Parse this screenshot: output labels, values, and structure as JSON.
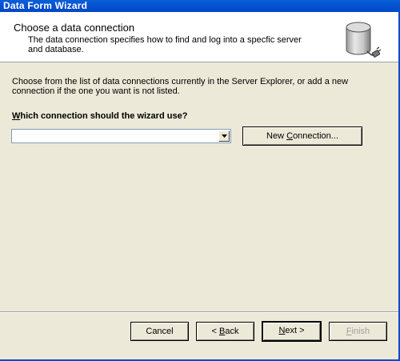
{
  "window": {
    "title": "Data Form Wizard"
  },
  "header": {
    "title": "Choose a data connection",
    "description": "The data connection specifies how to find and log into a specfic server and database."
  },
  "main": {
    "instructions": "Choose from the list of data connections currently in the Server Explorer, or add a new connection if the one you want is not listed.",
    "question_prefix": "W",
    "question_rest": "hich connection should the wizard use?",
    "connection_select": {
      "value": ""
    },
    "new_connection_button": {
      "prefix": "New ",
      "accel": "C",
      "rest": "onnection..."
    }
  },
  "footer": {
    "cancel": {
      "label": "Cancel"
    },
    "back": {
      "prefix": "< ",
      "accel": "B",
      "rest": "ack"
    },
    "next": {
      "accel": "N",
      "rest": "ext >"
    },
    "finish": {
      "accel": "F",
      "rest": "inish"
    }
  }
}
